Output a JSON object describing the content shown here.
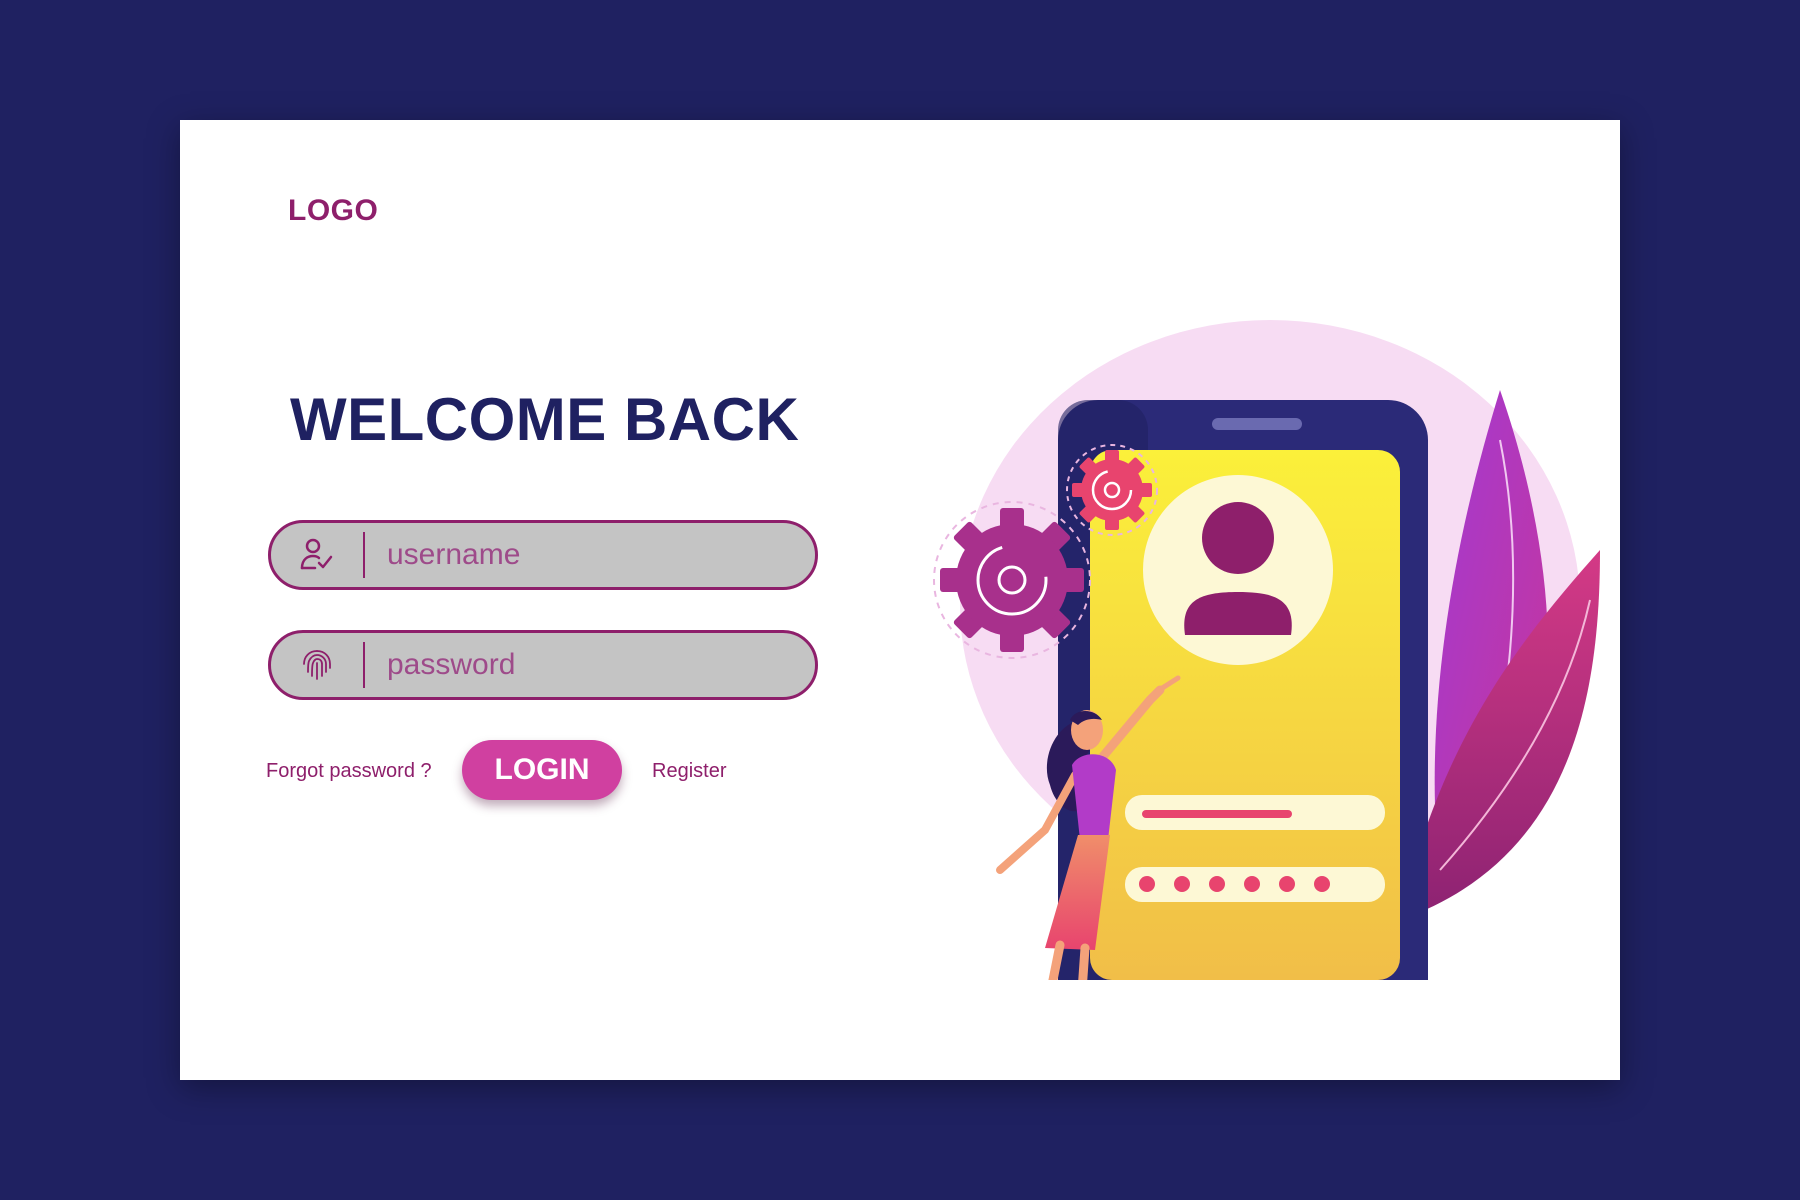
{
  "header": {
    "logo": "LOGO"
  },
  "main": {
    "title": "WELCOME BACK",
    "username": {
      "placeholder": "username",
      "value": "",
      "icon": "user-check-icon"
    },
    "password": {
      "placeholder": "password",
      "value": "",
      "icon": "fingerprint-icon"
    },
    "forgot_label": "Forgot password ?",
    "login_label": "LOGIN",
    "register_label": "Register"
  },
  "colors": {
    "background": "#1f2161",
    "accent": "#8e1f6b",
    "button": "#d040a0",
    "field": "#c4c4c4",
    "phone_screen": "#f9e84a"
  }
}
